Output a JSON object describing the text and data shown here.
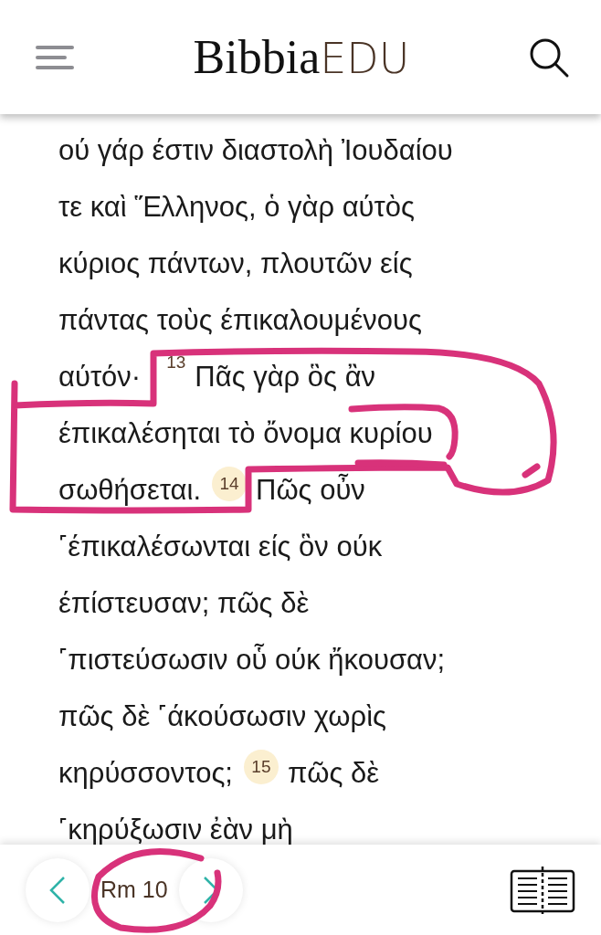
{
  "header": {
    "logo": {
      "main": "Bibbia",
      "accent": "EDU"
    }
  },
  "lines": [
    [
      {
        "kind": "text",
        "text": "ού γάρ έστιν διαστολὴ Ἰουδαίου"
      }
    ],
    [
      {
        "kind": "text",
        "text": "τε καὶ Ἕλληνος, ὁ γὰρ αύτὸς"
      }
    ],
    [
      {
        "kind": "text",
        "text": "κύριος πάντων, πλουτῶν είς"
      }
    ],
    [
      {
        "kind": "text",
        "text": "πάντας τοὺς έπικαλουμένους"
      }
    ],
    [
      {
        "kind": "text",
        "text": "αύτόν·"
      },
      {
        "kind": "verse",
        "text": "13",
        "highlighted": false
      },
      {
        "kind": "text",
        "text": "Πᾶς γὰρ ὃς ἂν"
      }
    ],
    [
      {
        "kind": "text",
        "text": "έπικαλέσηται τὸ ὄνομα κυρίου"
      }
    ],
    [
      {
        "kind": "text",
        "text": "σωθήσεται."
      },
      {
        "kind": "verse",
        "text": "14",
        "highlighted": true
      },
      {
        "kind": "text",
        "text": "Πῶς οὖν"
      }
    ],
    [
      {
        "kind": "text",
        "text": "˹έπικαλέσωνται είς ὃν ούκ"
      }
    ],
    [
      {
        "kind": "text",
        "text": "έπίστευσαν; πῶς δὲ"
      }
    ],
    [
      {
        "kind": "text",
        "text": "˹πιστεύσωσιν οὗ ούκ ἤκουσαν;"
      }
    ],
    [
      {
        "kind": "text",
        "text": "πῶς δὲ ˹άκούσωσιν χωρὶς"
      }
    ],
    [
      {
        "kind": "text",
        "text": "κηρύσσοντος;"
      },
      {
        "kind": "verse",
        "text": "15",
        "highlighted": true
      },
      {
        "kind": "text",
        "text": "πῶς δὲ"
      }
    ],
    [
      {
        "kind": "text",
        "text": "˹κηρύξωσιν ἐὰν μὴ"
      }
    ]
  ],
  "navigation": {
    "reference": "Rm 10"
  }
}
